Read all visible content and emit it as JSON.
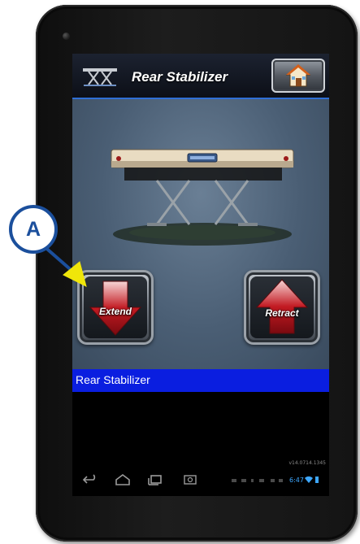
{
  "header": {
    "title": "Rear Stabilizer",
    "home_icon": "home-icon"
  },
  "controls": {
    "extend_label": "Extend",
    "retract_label": "Retract"
  },
  "status": {
    "text": "Rear Stabilizer"
  },
  "footer": {
    "version": "v14.0714.1345",
    "time": "6:47"
  },
  "callout": {
    "letter": "A"
  },
  "colors": {
    "status_bar": "#0a1ee0",
    "header_accent": "#2f6fd6",
    "callout_blue": "#1b4f9c",
    "callout_arrow": "#f0e60a",
    "arrow_red": "#b3131b"
  }
}
